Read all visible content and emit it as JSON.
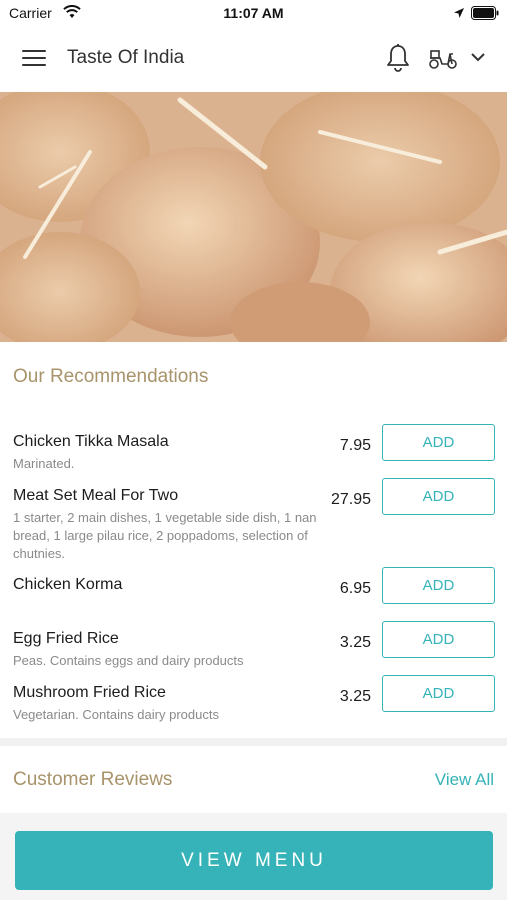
{
  "status_bar": {
    "carrier": "Carrier",
    "time": "11:07 AM"
  },
  "header": {
    "title": "Taste Of India",
    "icons": [
      "menu-icon",
      "bell-icon",
      "delivery-scooter-icon",
      "chevron-down-icon"
    ]
  },
  "recommendations": {
    "title": "Our Recommendations",
    "items": [
      {
        "name": "Chicken Tikka Masala",
        "description": "Marinated.",
        "price": "7.95",
        "add_label": "ADD"
      },
      {
        "name": "Meat Set Meal For Two",
        "description": "1 starter, 2 main dishes, 1 vegetable side dish, 1 nan bread, 1 large pilau rice, 2 poppadoms, selection of chutnies.",
        "price": "27.95",
        "add_label": "ADD"
      },
      {
        "name": "Chicken Korma",
        "description": "",
        "price": "6.95",
        "add_label": "ADD"
      },
      {
        "name": "Egg Fried Rice",
        "description": "Peas. Contains eggs and dairy products",
        "price": "3.25",
        "add_label": "ADD"
      },
      {
        "name": "Mushroom Fried Rice",
        "description": "Vegetarian. Contains dairy products",
        "price": "3.25",
        "add_label": "ADD"
      }
    ]
  },
  "reviews": {
    "title": "Customer Reviews",
    "view_all_label": "View All"
  },
  "cta": {
    "view_menu_label": "VIEW MENU"
  },
  "colors": {
    "accent": "#35b3b8",
    "section_title": "#a8936a",
    "text_primary": "#1c1c1c",
    "text_secondary": "#8a8a8a"
  }
}
